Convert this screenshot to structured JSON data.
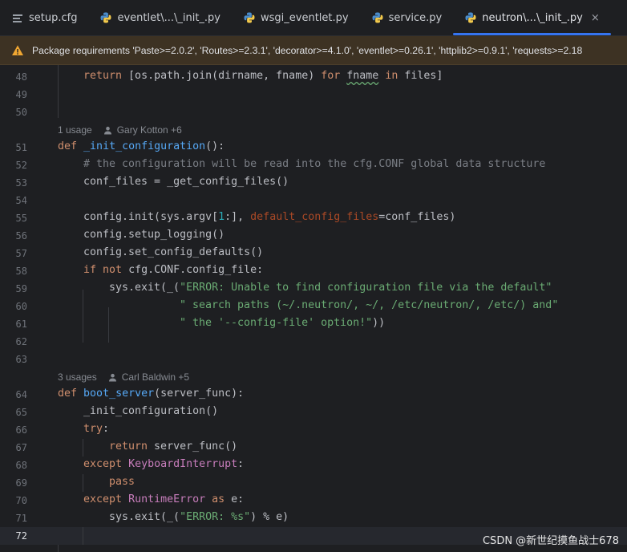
{
  "tabs": [
    {
      "label": "setup.cfg",
      "icon": "config-file-icon",
      "active": false
    },
    {
      "label": "eventlet\\...\\_init_.py",
      "icon": "python-icon",
      "active": false
    },
    {
      "label": "wsgi_eventlet.py",
      "icon": "python-icon",
      "active": false
    },
    {
      "label": "service.py",
      "icon": "python-icon",
      "active": false
    },
    {
      "label": "neutron\\...\\_init_.py",
      "icon": "python-icon",
      "active": true,
      "close": "×"
    }
  ],
  "banner": {
    "icon": "warning-icon",
    "text": "Package requirements 'Paste>=2.0.2', 'Routes>=2.3.1', 'decorator>=4.1.0', 'eventlet>=0.26.1', 'httplib2>=0.9.1', 'requests>=2.18"
  },
  "hints": [
    {
      "usage": "1 usage",
      "author": "Gary Kotton +6"
    },
    {
      "usage": "3 usages",
      "author": "Carl Baldwin +5"
    }
  ],
  "line_numbers": [
    "48",
    "49",
    "50",
    "51",
    "52",
    "53",
    "54",
    "55",
    "56",
    "57",
    "58",
    "59",
    "60",
    "61",
    "62",
    "63",
    "64",
    "65",
    "66",
    "67",
    "68",
    "69",
    "70",
    "71",
    "72"
  ],
  "code": {
    "l48": {
      "kw1": "return",
      "t1": " [os.path.join(dirname, fname) ",
      "kw2": "for",
      "t2": " ",
      "var": "fname",
      "t3": " ",
      "kw3": "in",
      "t4": " files]"
    },
    "l51": {
      "kw": "def",
      "fn": "_init_configuration",
      "rest": "():"
    },
    "l52": {
      "comment": "# the configuration will be read into the cfg.CONF global data structure"
    },
    "l53": {
      "text": "conf_files = _get_config_files()"
    },
    "l55": {
      "t1": "config.init(sys.argv[",
      "num": "1",
      "t2": ":], ",
      "param": "default_config_files",
      "t3": "=conf_files)"
    },
    "l56": {
      "text": "config.setup_logging()"
    },
    "l57": {
      "text": "config.set_config_defaults()"
    },
    "l58": {
      "kw1": "if",
      "kw2": "not",
      "rest": " cfg.CONF.config_file:"
    },
    "l59": {
      "t1": "sys.exit(_(",
      "str": "\"ERROR: Unable to find configuration file via the default\""
    },
    "l60": {
      "str": "\" search paths (~/.neutron/, ~/, /etc/neutron/, /etc/) and\""
    },
    "l61": {
      "str": "\" the '--config-file' option!\"",
      "rest": "))"
    },
    "l64": {
      "kw": "def",
      "fn": "boot_server",
      "rest": "(server_func):"
    },
    "l65": {
      "text": "_init_configuration()"
    },
    "l66": {
      "kw": "try",
      "rest": ":"
    },
    "l67": {
      "kw": "return",
      "rest": " server_func()"
    },
    "l68": {
      "kw": "except",
      "cls": "KeyboardInterrupt",
      "rest": ":"
    },
    "l69": {
      "kw": "pass"
    },
    "l70": {
      "kw1": "except",
      "cls": "RuntimeError",
      "kw2": "as",
      "rest": " e:"
    },
    "l71": {
      "t1": "sys.exit(_(",
      "str": "\"ERROR: %s\"",
      "rest": ") % e)"
    }
  },
  "watermark": "CSDN @新世纪摸鱼战士678",
  "colors": {
    "accent": "#3574f0",
    "keyword": "#cf8e6d",
    "function": "#56a8f5",
    "string": "#6aab73",
    "comment": "#7a7e85",
    "warning": "#f0a732"
  }
}
